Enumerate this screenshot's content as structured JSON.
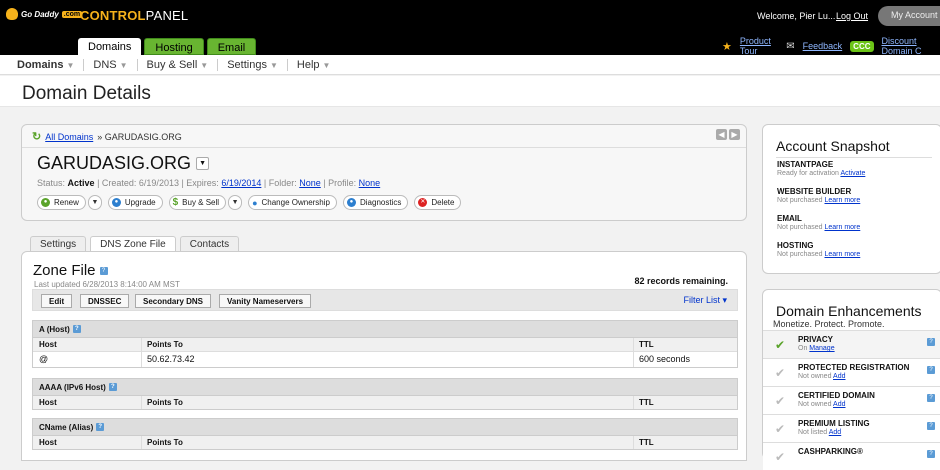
{
  "header": {
    "logo_text": "Go Daddy",
    "logo_tag": ".com",
    "app_title_bold": "CONTROL",
    "app_title_rest": "PANEL",
    "welcome": "Welcome, Pier Lu...",
    "logout": "Log Out",
    "my_account": "My Account",
    "tabs": [
      "Domains",
      "Hosting",
      "Email"
    ],
    "links": {
      "product_tour": "Product Tour",
      "feedback": "Feedback",
      "ccc_badge": "CCC",
      "discount": "Discount Domain C"
    }
  },
  "menu": [
    "Domains",
    "DNS",
    "Buy & Sell",
    "Settings",
    "Help"
  ],
  "page_title": "Domain Details",
  "domain": {
    "breadcrumb_link": "All Domains",
    "breadcrumb_current": "» GARUDASIG.ORG",
    "name": "GARUDASIG.ORG",
    "status_label": "Status:",
    "status_value": "Active",
    "created_label": "| Created: 6/19/2013 | Expires:",
    "expires": "6/19/2014",
    "folder_label": "| Folder:",
    "folder": "None",
    "profile_label": "| Profile:",
    "profile": "None",
    "actions": {
      "renew": "Renew",
      "upgrade": "Upgrade",
      "buy_sell": "Buy & Sell",
      "change_ownership": "Change Ownership",
      "diagnostics": "Diagnostics",
      "delete": "Delete"
    }
  },
  "subtabs": [
    "Settings",
    "DNS Zone File",
    "Contacts"
  ],
  "zone": {
    "title": "Zone File",
    "updated": "Last updated 6/28/2013 8:14:00 AM MST",
    "remaining": "82 records remaining.",
    "buttons": [
      "Edit",
      "DNSSEC",
      "Secondary DNS",
      "Vanity Nameservers"
    ],
    "filter": "Filter List ▾",
    "sections": [
      {
        "title": "A (Host)",
        "cols": [
          "Host",
          "Points To",
          "TTL"
        ],
        "rows": [
          [
            "@",
            "50.62.73.42",
            "600 seconds"
          ]
        ]
      },
      {
        "title": "AAAA (IPv6 Host)",
        "cols": [
          "Host",
          "Points To",
          "TTL"
        ],
        "rows": []
      },
      {
        "title": "CName (Alias)",
        "cols": [
          "Host",
          "Points To",
          "TTL"
        ],
        "rows": []
      }
    ]
  },
  "snapshot": {
    "title": "Account Snapshot",
    "items": [
      {
        "title": "INSTANTPAGE",
        "status": "Ready for activation",
        "link": "Activate"
      },
      {
        "title": "WEBSITE BUILDER",
        "status": "Not purchased",
        "link": "Learn more"
      },
      {
        "title": "EMAIL",
        "status": "Not purchased",
        "link": "Learn more"
      },
      {
        "title": "HOSTING",
        "status": "Not purchased",
        "link": "Learn more"
      }
    ]
  },
  "enhancements": {
    "title": "Domain Enhancements",
    "subtitle": "Monetize. Protect. Promote.",
    "items": [
      {
        "title": "PRIVACY",
        "status": "On",
        "link": "Manage"
      },
      {
        "title": "PROTECTED REGISTRATION",
        "status": "Not owned",
        "link": "Add"
      },
      {
        "title": "CERTIFIED DOMAIN",
        "status": "Not owned",
        "link": "Add"
      },
      {
        "title": "PREMIUM LISTING",
        "status": "Not listed",
        "link": "Add"
      },
      {
        "title": "CASHPARKING®",
        "status": "",
        "link": ""
      }
    ]
  }
}
